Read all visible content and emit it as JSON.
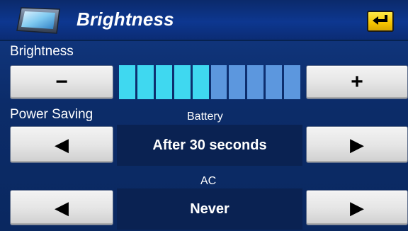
{
  "header": {
    "title": "Brightness",
    "screen_icon": "monitor-icon",
    "back_icon": "enter-return-icon",
    "accent_color": "#f5c400"
  },
  "brightness": {
    "label": "Brightness",
    "decrease_label": "−",
    "increase_label": "+",
    "level": 5,
    "max_level": 10,
    "on_color": "#3fd8f0",
    "off_color": "#5c97de"
  },
  "power_saving": {
    "label": "Power Saving",
    "battery": {
      "label": "Battery",
      "value": "After 30 seconds",
      "prev_icon": "left-triangle-icon",
      "next_icon": "right-triangle-icon"
    },
    "ac": {
      "label": "AC",
      "value": "Never",
      "prev_icon": "left-triangle-icon",
      "next_icon": "right-triangle-icon"
    }
  }
}
